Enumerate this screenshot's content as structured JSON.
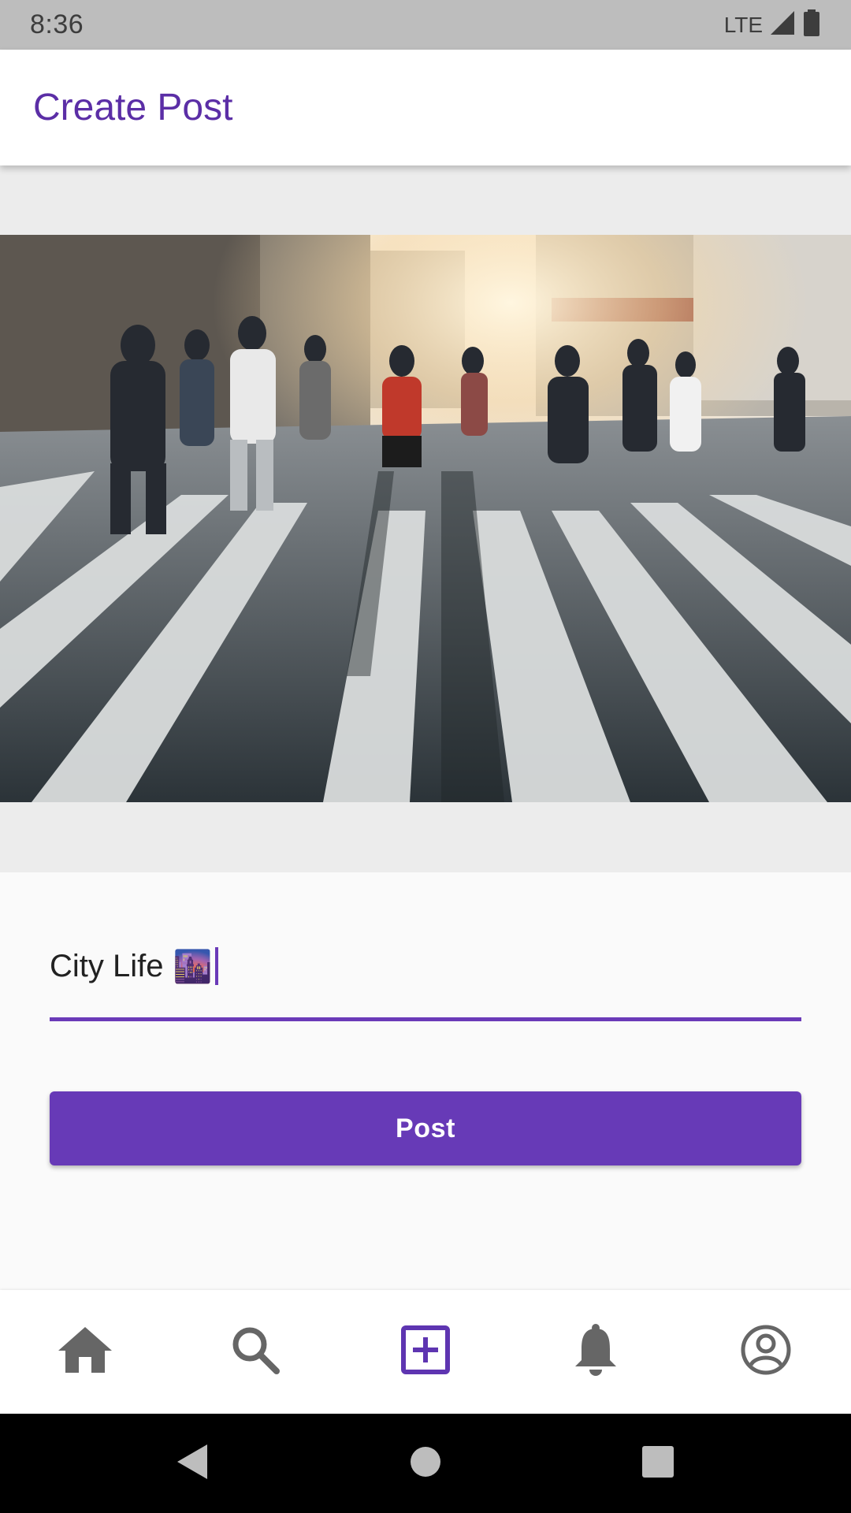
{
  "status_bar": {
    "time": "8:36",
    "network": "LTE"
  },
  "app_bar": {
    "title": "Create Post"
  },
  "photo": {
    "icon": "city-crosswalk-photo"
  },
  "caption": {
    "value": "City Life",
    "emoji": "🌆",
    "accent_color": "#6a3ab8"
  },
  "post_button": {
    "label": "Post",
    "color": "#673ab7"
  },
  "bottom_nav": {
    "items": [
      {
        "icon": "home-icon",
        "active": false
      },
      {
        "icon": "search-icon",
        "active": false
      },
      {
        "icon": "add-post-icon",
        "active": true
      },
      {
        "icon": "bell-icon",
        "active": false
      },
      {
        "icon": "account-icon",
        "active": false
      }
    ],
    "active_color": "#5e35b1",
    "inactive_color": "#666666"
  },
  "colors": {
    "brand": "#673ab7",
    "app_title": "#5b2ea6"
  }
}
